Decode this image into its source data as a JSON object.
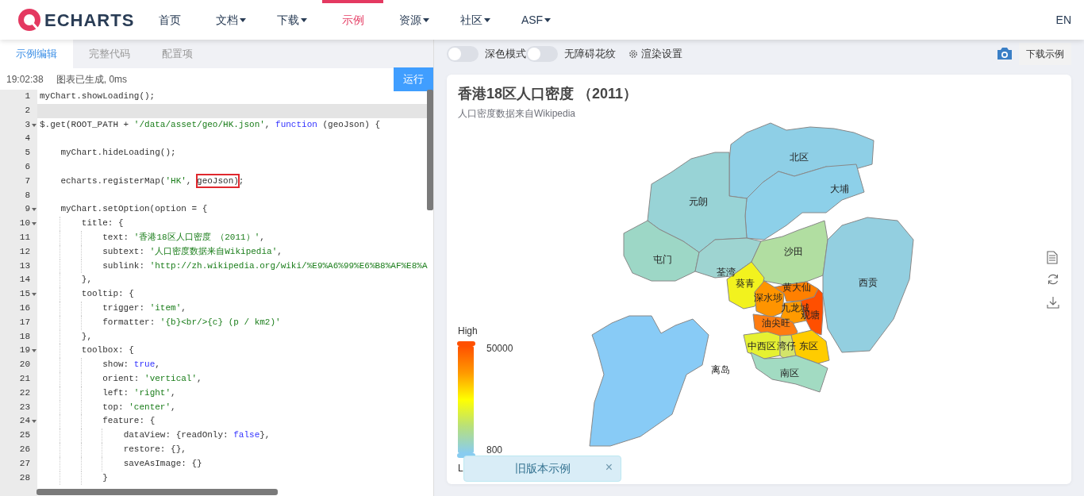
{
  "nav": {
    "logo": "ECHARTS",
    "items": [
      {
        "label": "首页",
        "dropdown": false,
        "selected": false
      },
      {
        "label": "文档",
        "dropdown": true,
        "selected": false
      },
      {
        "label": "下载",
        "dropdown": true,
        "selected": false
      },
      {
        "label": "示例",
        "dropdown": false,
        "selected": true
      },
      {
        "label": "资源",
        "dropdown": true,
        "selected": false
      },
      {
        "label": "社区",
        "dropdown": true,
        "selected": false
      },
      {
        "label": "ASF",
        "dropdown": true,
        "selected": false
      }
    ],
    "language": "EN"
  },
  "editor": {
    "tabs": [
      {
        "label": "示例编辑",
        "selected": true
      },
      {
        "label": "完整代码",
        "selected": false
      },
      {
        "label": "配置项",
        "selected": false
      }
    ],
    "status_time": "19:02:38",
    "status_text": "图表已生成, 0ms",
    "run_button": "运行",
    "lines": [
      {
        "num": "1",
        "fold": false,
        "current": false,
        "tokens": [
          {
            "kind": "plain",
            "text": "myChart.showLoading();"
          }
        ]
      },
      {
        "num": "2",
        "fold": false,
        "current": true
      },
      {
        "num": "3",
        "fold": true,
        "current": false,
        "tokens": [
          {
            "kind": "plain",
            "text": "$.get(ROOT_PATH + "
          },
          {
            "kind": "string",
            "text": "'/data/asset/geo/HK.json'"
          },
          {
            "kind": "plain",
            "text": ", "
          },
          {
            "kind": "keyword",
            "text": "function"
          },
          {
            "kind": "plain",
            "text": " (geoJson) {"
          }
        ]
      },
      {
        "num": "4",
        "fold": false,
        "current": false
      },
      {
        "num": "5",
        "fold": false,
        "current": false,
        "tokens": [
          {
            "kind": "plain",
            "text": "    myChart.hideLoading();"
          }
        ]
      },
      {
        "num": "6",
        "fold": false,
        "current": false
      },
      {
        "num": "7",
        "fold": false,
        "current": false,
        "tokens": [
          {
            "kind": "plain",
            "text": "    echarts.registerMap("
          },
          {
            "kind": "string",
            "text": "'HK'"
          },
          {
            "kind": "plain",
            "text": ", "
          },
          {
            "kind": "boxed",
            "text": "geoJson)"
          },
          {
            "kind": "plain",
            "text": ";"
          }
        ]
      },
      {
        "num": "8",
        "fold": false,
        "current": false
      },
      {
        "num": "9",
        "fold": true,
        "current": false,
        "tokens": [
          {
            "kind": "plain",
            "text": "    myChart.setOption(option = {"
          }
        ]
      },
      {
        "num": "10",
        "fold": true,
        "current": false,
        "tokens": [
          {
            "kind": "plain",
            "text": "        title: {"
          }
        ]
      },
      {
        "num": "11",
        "fold": false,
        "current": false,
        "tokens": [
          {
            "kind": "plain",
            "text": "            text: "
          },
          {
            "kind": "string",
            "text": "'香港18区人口密度 （2011）'"
          },
          {
            "kind": "plain",
            "text": ","
          }
        ]
      },
      {
        "num": "12",
        "fold": false,
        "current": false,
        "tokens": [
          {
            "kind": "plain",
            "text": "            subtext: "
          },
          {
            "kind": "string",
            "text": "'人口密度数据来自Wikipedia'"
          },
          {
            "kind": "plain",
            "text": ","
          }
        ]
      },
      {
        "num": "13",
        "fold": false,
        "current": false,
        "tokens": [
          {
            "kind": "plain",
            "text": "            sublink: "
          },
          {
            "kind": "string",
            "text": "'http://zh.wikipedia.org/wiki/%E9%A6%99%E6%B8%AF%E8%A"
          }
        ]
      },
      {
        "num": "14",
        "fold": false,
        "current": false,
        "tokens": [
          {
            "kind": "plain",
            "text": "        },"
          }
        ]
      },
      {
        "num": "15",
        "fold": true,
        "current": false,
        "tokens": [
          {
            "kind": "plain",
            "text": "        tooltip: {"
          }
        ]
      },
      {
        "num": "16",
        "fold": false,
        "current": false,
        "tokens": [
          {
            "kind": "plain",
            "text": "            trigger: "
          },
          {
            "kind": "string",
            "text": "'item'"
          },
          {
            "kind": "plain",
            "text": ","
          }
        ]
      },
      {
        "num": "17",
        "fold": false,
        "current": false,
        "tokens": [
          {
            "kind": "plain",
            "text": "            formatter: "
          },
          {
            "kind": "string",
            "text": "'{b}<br/>{c} (p / km2)'"
          }
        ]
      },
      {
        "num": "18",
        "fold": false,
        "current": false,
        "tokens": [
          {
            "kind": "plain",
            "text": "        },"
          }
        ]
      },
      {
        "num": "19",
        "fold": true,
        "current": false,
        "tokens": [
          {
            "kind": "plain",
            "text": "        toolbox: {"
          }
        ]
      },
      {
        "num": "20",
        "fold": false,
        "current": false,
        "tokens": [
          {
            "kind": "plain",
            "text": "            show: "
          },
          {
            "kind": "keyword",
            "text": "true"
          },
          {
            "kind": "plain",
            "text": ","
          }
        ]
      },
      {
        "num": "21",
        "fold": false,
        "current": false,
        "tokens": [
          {
            "kind": "plain",
            "text": "            orient: "
          },
          {
            "kind": "string",
            "text": "'vertical'"
          },
          {
            "kind": "plain",
            "text": ","
          }
        ]
      },
      {
        "num": "22",
        "fold": false,
        "current": false,
        "tokens": [
          {
            "kind": "plain",
            "text": "            left: "
          },
          {
            "kind": "string",
            "text": "'right'"
          },
          {
            "kind": "plain",
            "text": ","
          }
        ]
      },
      {
        "num": "23",
        "fold": false,
        "current": false,
        "tokens": [
          {
            "kind": "plain",
            "text": "            top: "
          },
          {
            "kind": "string",
            "text": "'center'"
          },
          {
            "kind": "plain",
            "text": ","
          }
        ]
      },
      {
        "num": "24",
        "fold": true,
        "current": false,
        "tokens": [
          {
            "kind": "plain",
            "text": "            feature: {"
          }
        ]
      },
      {
        "num": "25",
        "fold": false,
        "current": false,
        "tokens": [
          {
            "kind": "plain",
            "text": "                dataView: {readOnly: "
          },
          {
            "kind": "keyword",
            "text": "false"
          },
          {
            "kind": "plain",
            "text": "},"
          }
        ]
      },
      {
        "num": "26",
        "fold": false,
        "current": false,
        "tokens": [
          {
            "kind": "plain",
            "text": "                restore: {},"
          }
        ]
      },
      {
        "num": "27",
        "fold": false,
        "current": false,
        "tokens": [
          {
            "kind": "plain",
            "text": "                saveAsImage: {}"
          }
        ]
      },
      {
        "num": "28",
        "fold": false,
        "current": false,
        "tokens": [
          {
            "kind": "plain",
            "text": "            }"
          }
        ]
      }
    ]
  },
  "preview": {
    "toggles": [
      {
        "label": "深色模式",
        "on": false
      },
      {
        "label": "无障碍花纹",
        "on": false
      }
    ],
    "render_settings": "渲染设置",
    "download_button": "下载示例",
    "chart": {
      "title": "香港18区人口密度 （2011）",
      "subtitle": "人口密度数据来自Wikipedia",
      "regions": [
        {
          "name": "北区",
          "color": "#8ecfe6"
        },
        {
          "name": "大埔",
          "color": "#8dd0e9"
        },
        {
          "name": "元朗",
          "color": "#98d3d6"
        },
        {
          "name": "屯门",
          "color": "#9dd7c6"
        },
        {
          "name": "荃湾",
          "color": "#9ed4d1"
        },
        {
          "name": "沙田",
          "color": "#b1dea1"
        },
        {
          "name": "葵青",
          "color": "#f2f21e"
        },
        {
          "name": "深水埗",
          "color": "#ff9400"
        },
        {
          "name": "黄大仙",
          "color": "#ff8000"
        },
        {
          "name": "九龙城",
          "color": "#ff9a00"
        },
        {
          "name": "油尖旺",
          "color": "#ff7c10"
        },
        {
          "name": "观塘",
          "color": "#ff4f00"
        },
        {
          "name": "西贡",
          "color": "#93cfe0"
        },
        {
          "name": "中西区",
          "color": "#e6f132"
        },
        {
          "name": "湾仔",
          "color": "#d4e46a"
        },
        {
          "name": "东区",
          "color": "#ffcc00"
        },
        {
          "name": "南区",
          "color": "#a2dbc2"
        },
        {
          "name": "离岛",
          "color": "#88cbf6"
        }
      ],
      "visual_map": {
        "high_label": "High",
        "max": "50000",
        "min": "800",
        "low_label": "L"
      }
    },
    "notice": {
      "text": "旧版本示例",
      "close": "×"
    }
  }
}
